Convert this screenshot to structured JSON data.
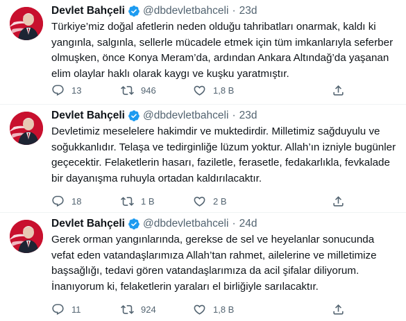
{
  "colors": {
    "icon_gray": "#536471",
    "verified_blue": "#1d9bf0",
    "avatar_red": "#c8102e"
  },
  "tweets": [
    {
      "name": "Devlet Bahçeli",
      "handle": "@dbdevletbahceli",
      "separator": "·",
      "time": "23d",
      "text": "Türkiye’miz doğal afetlerin neden olduğu tahribatları onarmak, kaldı ki yangınla, salgınla, sellerle mücadele etmek için tüm imkanlarıyla seferber olmuşken, önce Konya Meram’da, ardından Ankara Altındağ’da yaşanan elim olaylar haklı olarak kaygı ve kuşku yaratmıştır.",
      "replies": "13",
      "retweets": "946",
      "likes": "1,8 B"
    },
    {
      "name": "Devlet Bahçeli",
      "handle": "@dbdevletbahceli",
      "separator": "·",
      "time": "23d",
      "text": "Devletimiz meselelere hakimdir ve muktedirdir. Milletimiz sağduyulu ve soğukkanlıdır. Telaşa ve tedirginliğe lüzum yoktur. Allah’ın izniyle bugünler geçecektir. Felaketlerin hasarı, faziletle, ferasetle, fedakarlıkla, fevkalade bir dayanışma ruhuyla ortadan kaldırılacaktır.",
      "replies": "18",
      "retweets": "1 B",
      "likes": "2 B"
    },
    {
      "name": "Devlet Bahçeli",
      "handle": "@dbdevletbahceli",
      "separator": "·",
      "time": "24d",
      "text": "Gerek orman yangınlarında, gerekse de sel ve heyelanlar sonucunda vefat eden vatandaşlarımıza Allah’tan rahmet, ailelerine ve milletimize başsağlığı, tedavi gören vatandaşlarımıza da acil şifalar diliyorum. İnanıyorum ki, felaketlerin yaraları el birliğiyle sarılacaktır.",
      "replies": "11",
      "retweets": "924",
      "likes": "1,8 B"
    }
  ]
}
